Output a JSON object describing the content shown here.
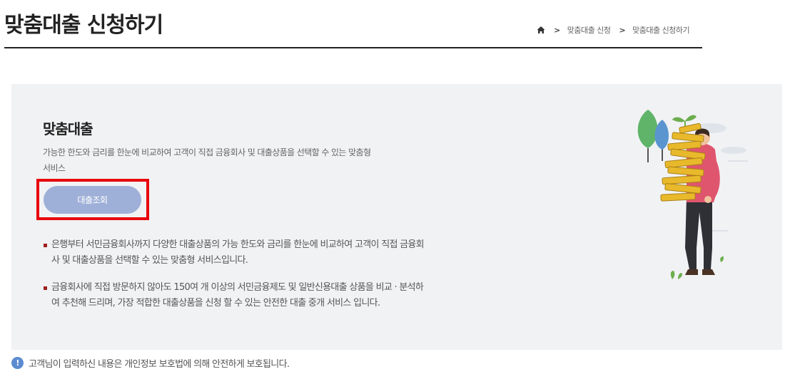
{
  "header": {
    "title": "맞춤대출 신청하기",
    "breadcrumb": {
      "home_icon": "home-icon",
      "separator": ">",
      "items": [
        "맞춤대출 신청",
        "맞춤대출 신청하기"
      ]
    }
  },
  "panel": {
    "title": "맞춤대출",
    "description": "가능한 한도와 금리를 한눈에 비교하여 고객이 직접 금융회사 및 대출상품을 선택할 수 있는 맞춤형 서비스",
    "button_label": "대출조회",
    "bullets": [
      "은행부터 서민금융회사까지 다양한 대출상품의 가능 한도와 금리를 한눈에 비교하여 고객이 직접 금융회사 및 대출상품을 선택할 수 있는 맞춤형 서비스입니다.",
      "금융회사에 직접 방문하지 않아도 150여 개 이상의 서민금융제도 및 일반신용대출 상품을 비교 · 분석하여 추천해 드리며, 가장 적합한 대출상품을 신청 할 수 있는 안전한 대출 중개 서비스 입니다."
    ],
    "illustration": "person-carrying-stack-of-coins-illustration"
  },
  "notice": {
    "icon": "info-icon",
    "icon_glyph": "!",
    "text": "고객님이 입력하신 내용은 개인정보 보호법에 의해 안전하게 보호됩니다."
  },
  "colors": {
    "panel_bg": "#f1f2f4",
    "button_bg": "#9fb0d8",
    "highlight": "#e8000b",
    "bullet": "#a02020",
    "info": "#5b8bd0"
  }
}
